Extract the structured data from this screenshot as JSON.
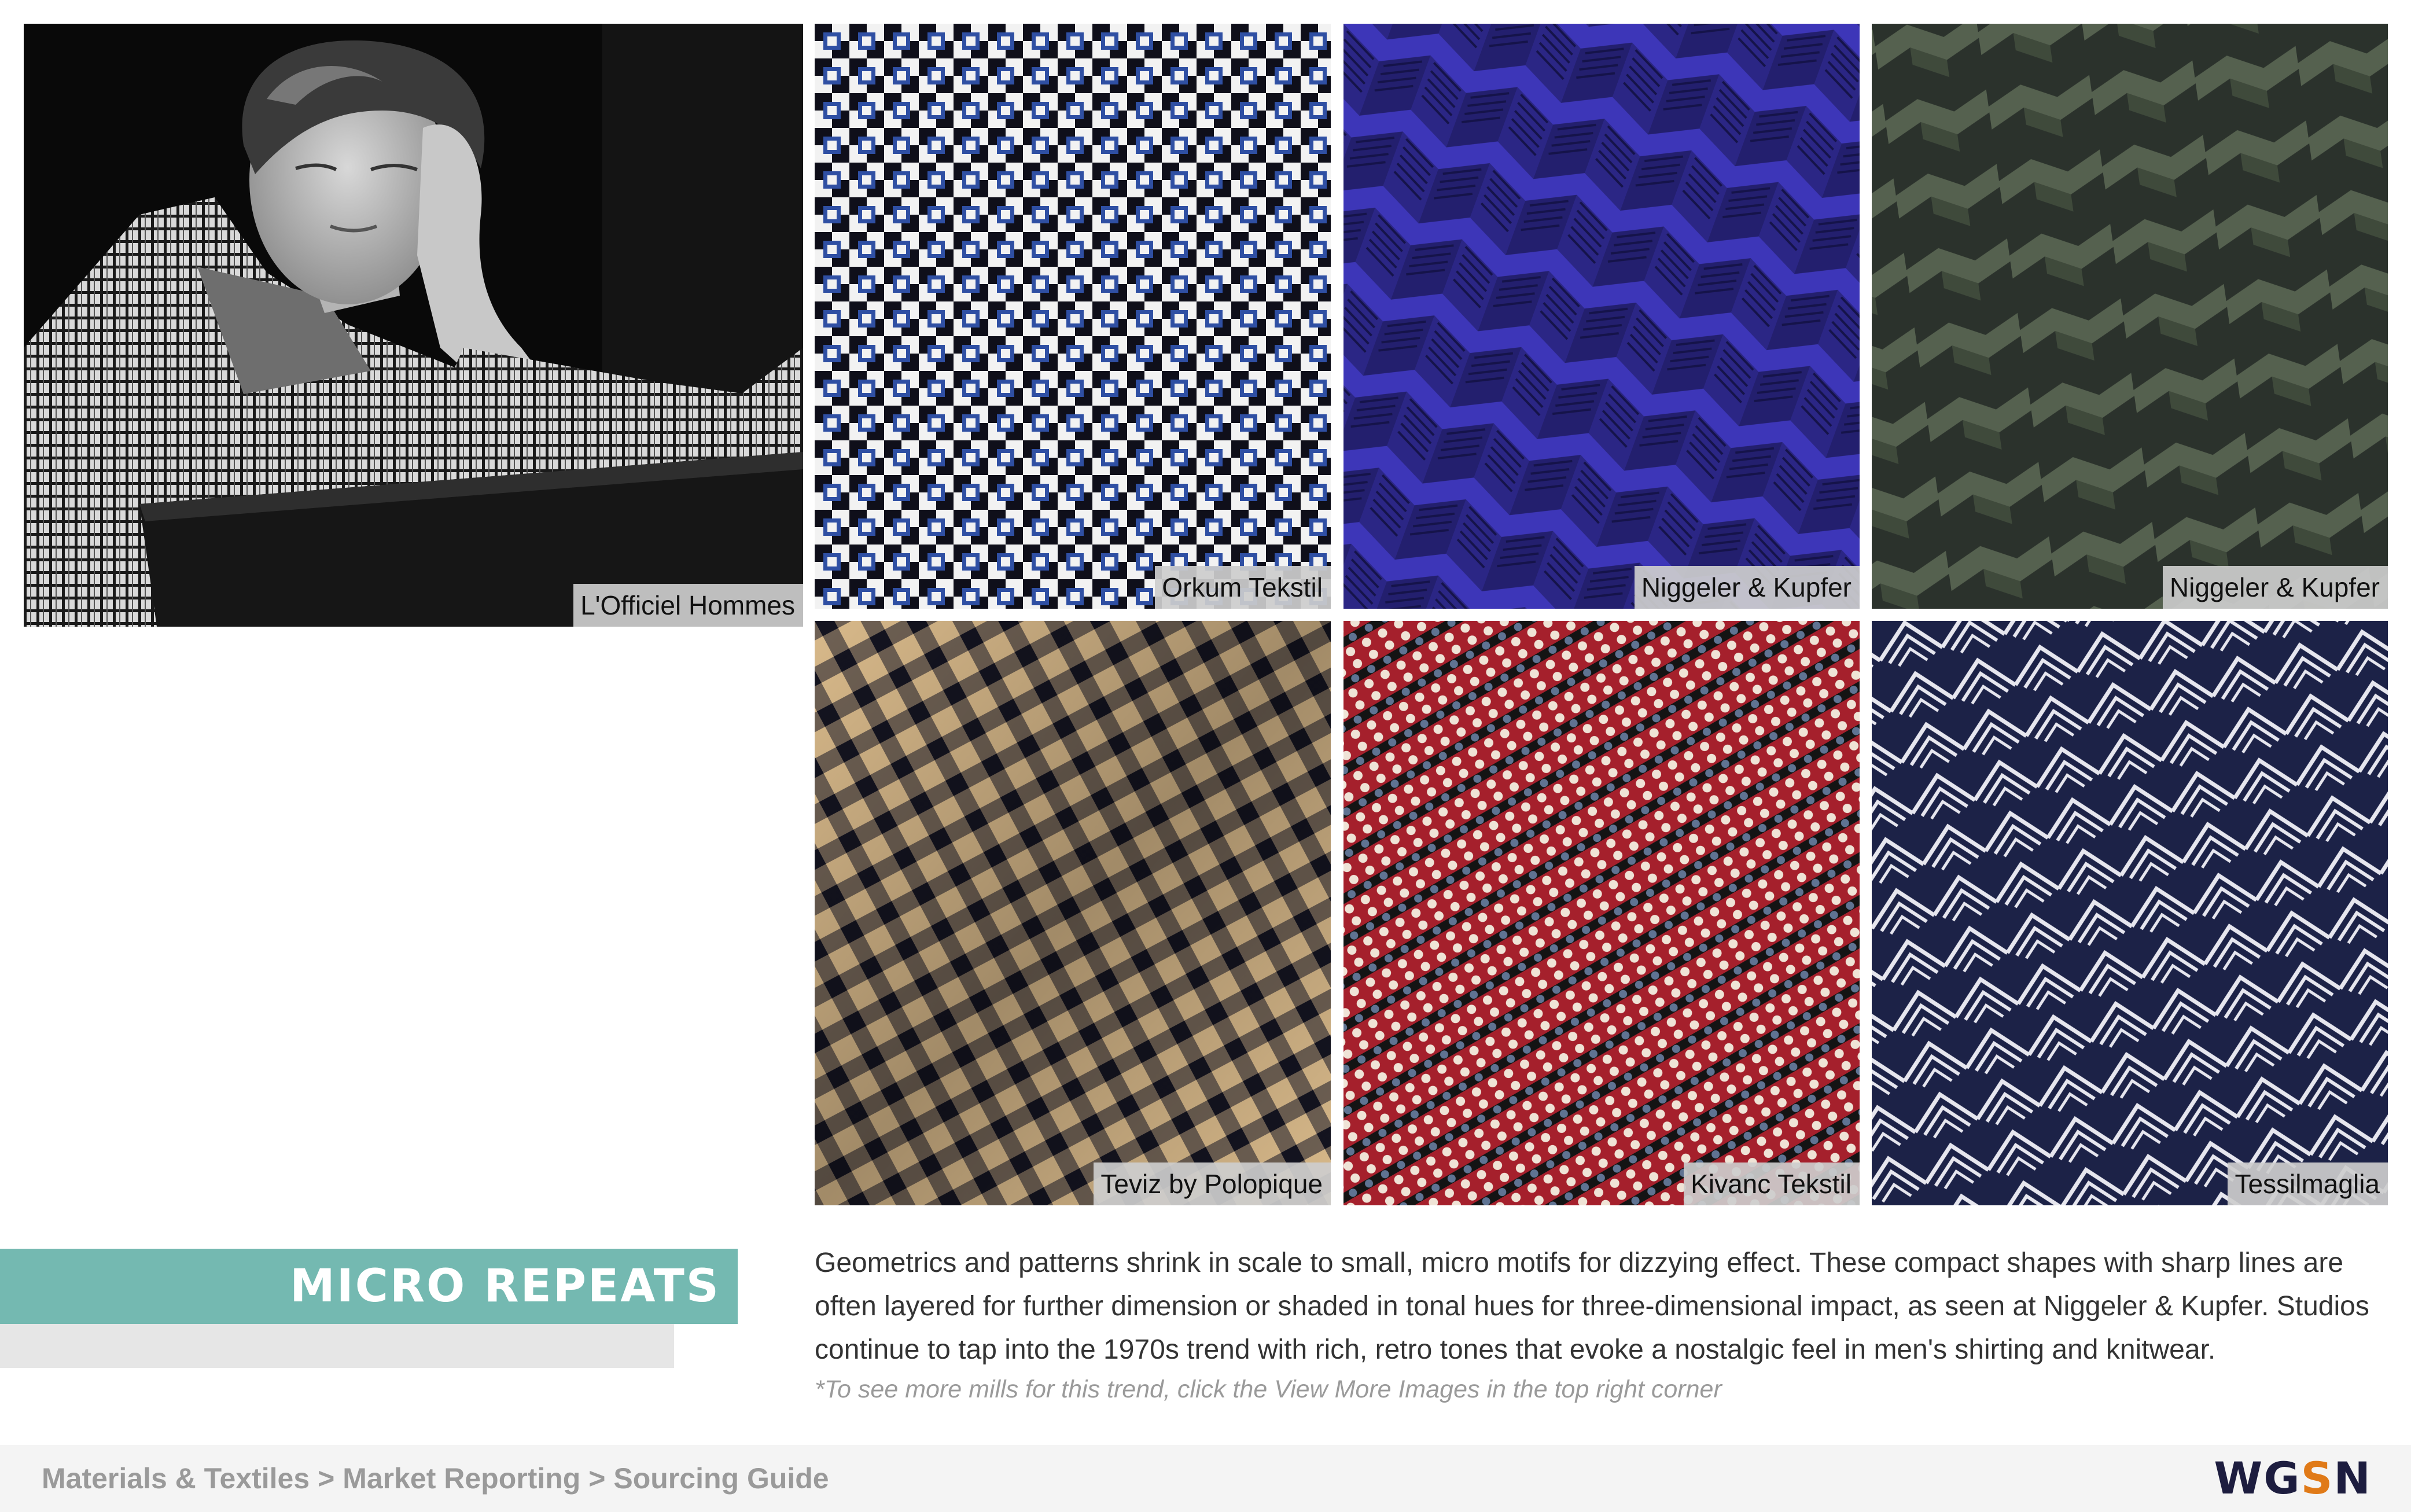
{
  "colors": {
    "accent_teal": "#74b9b1",
    "logo_dark": "#1d1d3f",
    "logo_orange": "#e07a18",
    "footer_text": "#9a9a9a"
  },
  "hero": {
    "credit": "L'Officiel Hommes"
  },
  "swatches": [
    {
      "credit": "Orkum Tekstil"
    },
    {
      "credit": "Niggeler & Kupfer"
    },
    {
      "credit": "Niggeler & Kupfer"
    },
    {
      "credit": "Teviz by Polopique"
    },
    {
      "credit": "Kivanc Tekstil"
    },
    {
      "credit": "Tessilmaglia"
    }
  ],
  "trend": {
    "title": "MICRO REPEATS",
    "description": "Geometrics and patterns shrink in scale to small, micro motifs for dizzying effect. These compact shapes with sharp lines are often layered for further dimension or shaded in tonal hues for three-dimensional impact, as seen at Niggeler & Kupfer. Studios continue to tap into the 1970s trend with rich, retro tones that evoke a nostalgic feel in men's shirting and knitwear.",
    "note": "*To see more mills for this trend, click the View More Images in the top right corner"
  },
  "footer": {
    "breadcrumb": [
      "Materials & Textiles",
      "Market Reporting",
      "Sourcing Guide"
    ],
    "separator": ">",
    "logo": {
      "part1": "WG",
      "part2": "S",
      "part3": "N"
    }
  }
}
